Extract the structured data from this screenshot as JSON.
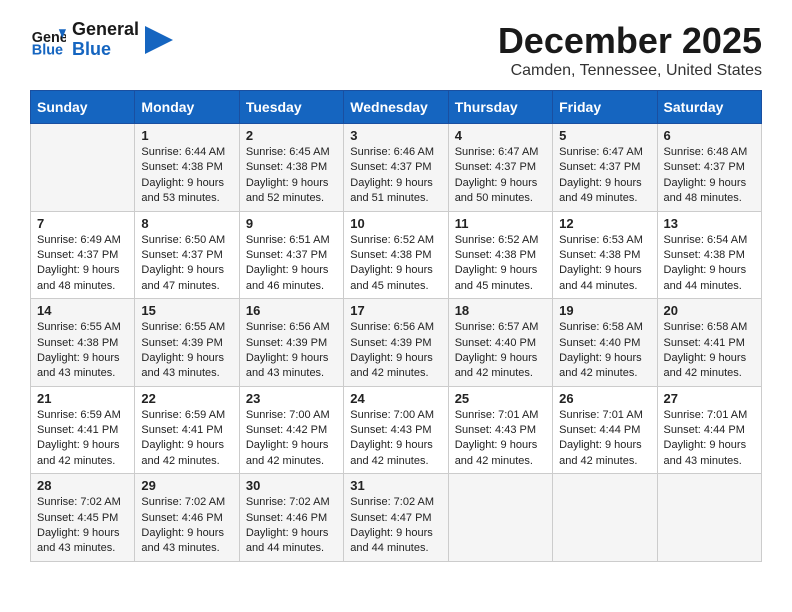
{
  "header": {
    "logo_line1": "General",
    "logo_line2": "Blue",
    "month_title": "December 2025",
    "location": "Camden, Tennessee, United States"
  },
  "weekdays": [
    "Sunday",
    "Monday",
    "Tuesday",
    "Wednesday",
    "Thursday",
    "Friday",
    "Saturday"
  ],
  "weeks": [
    [
      {
        "num": "",
        "sunrise": "",
        "sunset": "",
        "daylight": ""
      },
      {
        "num": "1",
        "sunrise": "Sunrise: 6:44 AM",
        "sunset": "Sunset: 4:38 PM",
        "daylight": "Daylight: 9 hours and 53 minutes."
      },
      {
        "num": "2",
        "sunrise": "Sunrise: 6:45 AM",
        "sunset": "Sunset: 4:38 PM",
        "daylight": "Daylight: 9 hours and 52 minutes."
      },
      {
        "num": "3",
        "sunrise": "Sunrise: 6:46 AM",
        "sunset": "Sunset: 4:37 PM",
        "daylight": "Daylight: 9 hours and 51 minutes."
      },
      {
        "num": "4",
        "sunrise": "Sunrise: 6:47 AM",
        "sunset": "Sunset: 4:37 PM",
        "daylight": "Daylight: 9 hours and 50 minutes."
      },
      {
        "num": "5",
        "sunrise": "Sunrise: 6:47 AM",
        "sunset": "Sunset: 4:37 PM",
        "daylight": "Daylight: 9 hours and 49 minutes."
      },
      {
        "num": "6",
        "sunrise": "Sunrise: 6:48 AM",
        "sunset": "Sunset: 4:37 PM",
        "daylight": "Daylight: 9 hours and 48 minutes."
      }
    ],
    [
      {
        "num": "7",
        "sunrise": "Sunrise: 6:49 AM",
        "sunset": "Sunset: 4:37 PM",
        "daylight": "Daylight: 9 hours and 48 minutes."
      },
      {
        "num": "8",
        "sunrise": "Sunrise: 6:50 AM",
        "sunset": "Sunset: 4:37 PM",
        "daylight": "Daylight: 9 hours and 47 minutes."
      },
      {
        "num": "9",
        "sunrise": "Sunrise: 6:51 AM",
        "sunset": "Sunset: 4:37 PM",
        "daylight": "Daylight: 9 hours and 46 minutes."
      },
      {
        "num": "10",
        "sunrise": "Sunrise: 6:52 AM",
        "sunset": "Sunset: 4:38 PM",
        "daylight": "Daylight: 9 hours and 45 minutes."
      },
      {
        "num": "11",
        "sunrise": "Sunrise: 6:52 AM",
        "sunset": "Sunset: 4:38 PM",
        "daylight": "Daylight: 9 hours and 45 minutes."
      },
      {
        "num": "12",
        "sunrise": "Sunrise: 6:53 AM",
        "sunset": "Sunset: 4:38 PM",
        "daylight": "Daylight: 9 hours and 44 minutes."
      },
      {
        "num": "13",
        "sunrise": "Sunrise: 6:54 AM",
        "sunset": "Sunset: 4:38 PM",
        "daylight": "Daylight: 9 hours and 44 minutes."
      }
    ],
    [
      {
        "num": "14",
        "sunrise": "Sunrise: 6:55 AM",
        "sunset": "Sunset: 4:38 PM",
        "daylight": "Daylight: 9 hours and 43 minutes."
      },
      {
        "num": "15",
        "sunrise": "Sunrise: 6:55 AM",
        "sunset": "Sunset: 4:39 PM",
        "daylight": "Daylight: 9 hours and 43 minutes."
      },
      {
        "num": "16",
        "sunrise": "Sunrise: 6:56 AM",
        "sunset": "Sunset: 4:39 PM",
        "daylight": "Daylight: 9 hours and 43 minutes."
      },
      {
        "num": "17",
        "sunrise": "Sunrise: 6:56 AM",
        "sunset": "Sunset: 4:39 PM",
        "daylight": "Daylight: 9 hours and 42 minutes."
      },
      {
        "num": "18",
        "sunrise": "Sunrise: 6:57 AM",
        "sunset": "Sunset: 4:40 PM",
        "daylight": "Daylight: 9 hours and 42 minutes."
      },
      {
        "num": "19",
        "sunrise": "Sunrise: 6:58 AM",
        "sunset": "Sunset: 4:40 PM",
        "daylight": "Daylight: 9 hours and 42 minutes."
      },
      {
        "num": "20",
        "sunrise": "Sunrise: 6:58 AM",
        "sunset": "Sunset: 4:41 PM",
        "daylight": "Daylight: 9 hours and 42 minutes."
      }
    ],
    [
      {
        "num": "21",
        "sunrise": "Sunrise: 6:59 AM",
        "sunset": "Sunset: 4:41 PM",
        "daylight": "Daylight: 9 hours and 42 minutes."
      },
      {
        "num": "22",
        "sunrise": "Sunrise: 6:59 AM",
        "sunset": "Sunset: 4:41 PM",
        "daylight": "Daylight: 9 hours and 42 minutes."
      },
      {
        "num": "23",
        "sunrise": "Sunrise: 7:00 AM",
        "sunset": "Sunset: 4:42 PM",
        "daylight": "Daylight: 9 hours and 42 minutes."
      },
      {
        "num": "24",
        "sunrise": "Sunrise: 7:00 AM",
        "sunset": "Sunset: 4:43 PM",
        "daylight": "Daylight: 9 hours and 42 minutes."
      },
      {
        "num": "25",
        "sunrise": "Sunrise: 7:01 AM",
        "sunset": "Sunset: 4:43 PM",
        "daylight": "Daylight: 9 hours and 42 minutes."
      },
      {
        "num": "26",
        "sunrise": "Sunrise: 7:01 AM",
        "sunset": "Sunset: 4:44 PM",
        "daylight": "Daylight: 9 hours and 42 minutes."
      },
      {
        "num": "27",
        "sunrise": "Sunrise: 7:01 AM",
        "sunset": "Sunset: 4:44 PM",
        "daylight": "Daylight: 9 hours and 43 minutes."
      }
    ],
    [
      {
        "num": "28",
        "sunrise": "Sunrise: 7:02 AM",
        "sunset": "Sunset: 4:45 PM",
        "daylight": "Daylight: 9 hours and 43 minutes."
      },
      {
        "num": "29",
        "sunrise": "Sunrise: 7:02 AM",
        "sunset": "Sunset: 4:46 PM",
        "daylight": "Daylight: 9 hours and 43 minutes."
      },
      {
        "num": "30",
        "sunrise": "Sunrise: 7:02 AM",
        "sunset": "Sunset: 4:46 PM",
        "daylight": "Daylight: 9 hours and 44 minutes."
      },
      {
        "num": "31",
        "sunrise": "Sunrise: 7:02 AM",
        "sunset": "Sunset: 4:47 PM",
        "daylight": "Daylight: 9 hours and 44 minutes."
      },
      {
        "num": "",
        "sunrise": "",
        "sunset": "",
        "daylight": ""
      },
      {
        "num": "",
        "sunrise": "",
        "sunset": "",
        "daylight": ""
      },
      {
        "num": "",
        "sunrise": "",
        "sunset": "",
        "daylight": ""
      }
    ]
  ]
}
